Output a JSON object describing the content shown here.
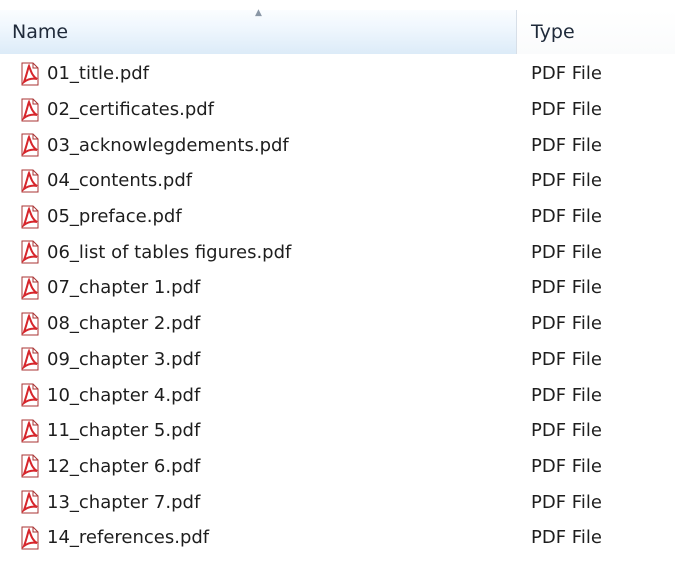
{
  "columns": {
    "name": "Name",
    "type": "Type"
  },
  "icons": {
    "file": "pdf-file-icon",
    "sort": "sort-arrow-icon"
  },
  "colors": {
    "pdf_icon_red": "#d7262c",
    "header_selected_bg": "#dcebf8"
  },
  "files": [
    {
      "name": "01_title.pdf",
      "type": "PDF File"
    },
    {
      "name": "02_certificates.pdf",
      "type": "PDF File"
    },
    {
      "name": "03_acknowlegdements.pdf",
      "type": "PDF File"
    },
    {
      "name": "04_contents.pdf",
      "type": "PDF File"
    },
    {
      "name": "05_preface.pdf",
      "type": "PDF File"
    },
    {
      "name": "06_list of tables figures.pdf",
      "type": "PDF File"
    },
    {
      "name": "07_chapter 1.pdf",
      "type": "PDF File"
    },
    {
      "name": "08_chapter 2.pdf",
      "type": "PDF File"
    },
    {
      "name": "09_chapter 3.pdf",
      "type": "PDF File"
    },
    {
      "name": "10_chapter 4.pdf",
      "type": "PDF File"
    },
    {
      "name": "11_chapter 5.pdf",
      "type": "PDF File"
    },
    {
      "name": "12_chapter 6.pdf",
      "type": "PDF File"
    },
    {
      "name": "13_chapter 7.pdf",
      "type": "PDF File"
    },
    {
      "name": "14_references.pdf",
      "type": "PDF File"
    }
  ]
}
